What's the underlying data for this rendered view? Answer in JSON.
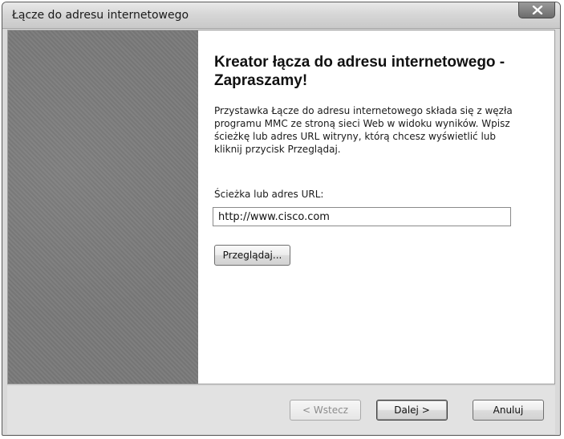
{
  "window": {
    "title": "Łącze do adresu internetowego",
    "close_icon": "close-icon"
  },
  "wizard": {
    "heading": "Kreator łącza do adresu internetowego - Zapraszamy!",
    "description": "Przystawka Łącze do adresu internetowego składa się z węzła programu MMC ze stroną sieci Web w widoku wyników. Wpisz ścieżkę lub adres URL witryny, którą chcesz wyświetlić lub kliknij przycisk Przeglądaj.",
    "url_label": "Ścieżka lub adres URL:",
    "url_value": "http://www.cisco.com",
    "browse_label": "Przeglądaj..."
  },
  "footer": {
    "back_label": "< Wstecz",
    "next_label": "Dalej >",
    "cancel_label": "Anuluj"
  }
}
